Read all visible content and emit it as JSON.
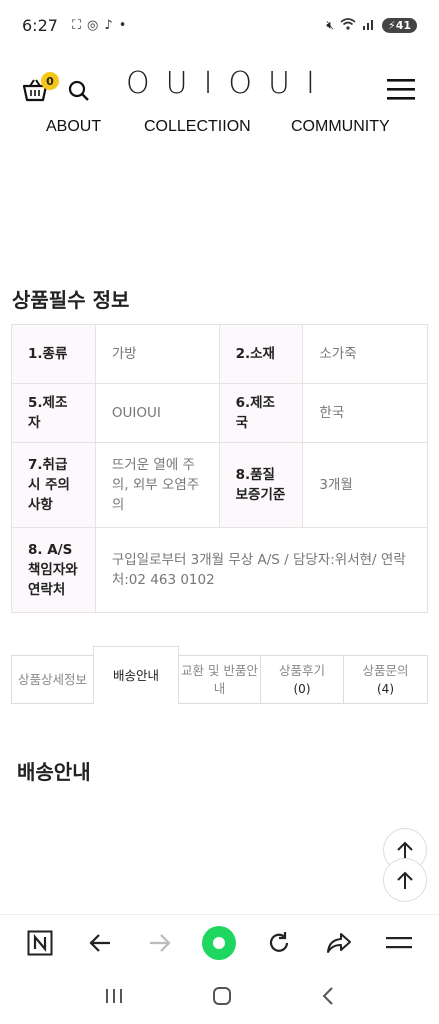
{
  "status_bar": {
    "time": "6:27",
    "battery": "41"
  },
  "header": {
    "logo": "OUIOUI",
    "cart_count": "0",
    "nav": [
      "ABOUT",
      "COLLECTIION",
      "COMMUNITY"
    ]
  },
  "section_title": "상품필수 정보",
  "info_table": {
    "rows": [
      {
        "k1": "1.종류",
        "v1": "가방",
        "k2": "2.소재",
        "v2": "소가죽"
      },
      {
        "k1": "5.제조자",
        "v1": "OUIOUI",
        "k2": "6.제조국",
        "v2": "한국"
      },
      {
        "k1": "7.취급시 주의사항",
        "v1": "뜨거운 열에 주의, 외부 오염주의",
        "k2": "8.품질보증기준",
        "v2": "3개월"
      }
    ],
    "last_row": {
      "k": "8. A/S 책임자와 연락처",
      "v": "구입일로부터 3개월 무상 A/S / 담당자:위서현/ 연락처:02 463 0102"
    }
  },
  "tabs": [
    {
      "label": "상품상세정보",
      "count": ""
    },
    {
      "label": "배송안내",
      "count": ""
    },
    {
      "label": "교환 및 반품안내",
      "count": ""
    },
    {
      "label": "상품후기",
      "count": "(0)"
    },
    {
      "label": "상품문의",
      "count": "(4)"
    }
  ],
  "delivery_title": "배송안내",
  "colors": {
    "accent": "#f5c518",
    "browser_home": "#1ed760"
  }
}
